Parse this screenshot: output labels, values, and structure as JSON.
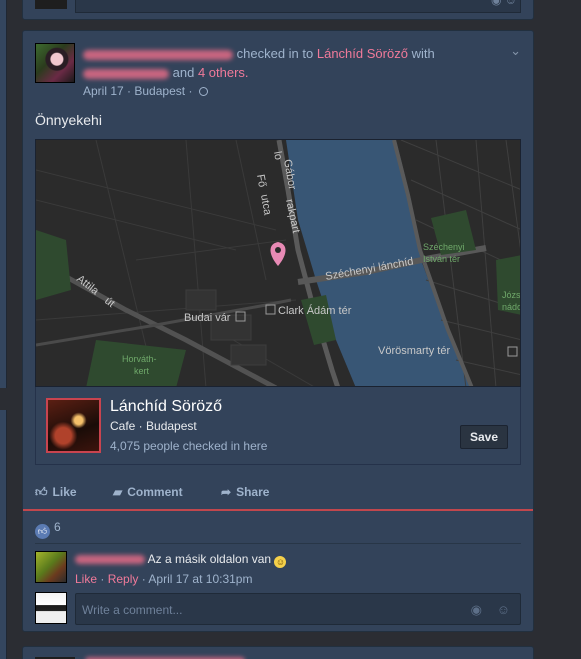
{
  "post": {
    "checkin_text": "checked in to",
    "place_link": "Lánchíd Söröző",
    "with_text": "with",
    "and_text": "and",
    "others_link": "4 others.",
    "date": "April 17",
    "location": "Budapest",
    "status_text": "Önnyekehi"
  },
  "map_labels": {
    "street_gabor": "Gábor",
    "street_lo": "lo",
    "street_fo": "Fő",
    "street_utca": "utca",
    "street_rakpart": "rakpart",
    "street_szechenyi": "Széchenyi lánchíd",
    "street_attila": "Attila",
    "street_ut": "út",
    "szechenyi_ter_1": "Széchenyi",
    "szechenyi_ter_2": "István tér",
    "budai_var": "Budai vár",
    "clark": "Clark Ádám tér",
    "jozsef_1": "Józse",
    "jozsef_2": "nádor",
    "horvath_1": "Horváth-",
    "horvath_2": "kert",
    "vorosmarty": "Vörösmarty tér"
  },
  "place": {
    "name": "Lánchíd Söröző",
    "category": "Cafe · Budapest",
    "checkins": "4,075 people checked in here",
    "save_label": "Save"
  },
  "actions": {
    "like": "Like",
    "comment": "Comment",
    "share": "Share"
  },
  "reactions": {
    "count": "6"
  },
  "comment": {
    "text": "Az a másik oldalon van",
    "like": "Like",
    "sep": "·",
    "reply": "Reply",
    "time": "April 17 at 10:31pm"
  },
  "composer": {
    "placeholder": "Write a comment..."
  },
  "colors": {
    "card_bg": "#33435a",
    "link_pink": "#f07a9a",
    "meta_blue": "#9fb3cc",
    "accent_red": "#c2474d",
    "map_water": "#385675"
  }
}
